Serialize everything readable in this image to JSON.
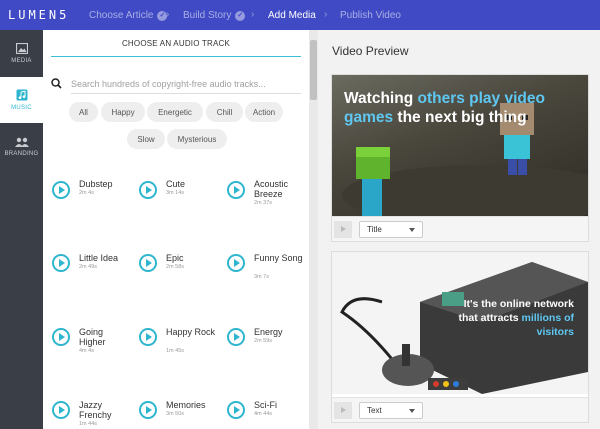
{
  "app": {
    "logo": "LUMEN5"
  },
  "steps": [
    {
      "label": "Choose Article",
      "done": true
    },
    {
      "label": "Build Story",
      "done": true
    },
    {
      "label": "Add Media",
      "done": false,
      "active": true
    },
    {
      "label": "Publish Video",
      "done": false
    }
  ],
  "rail": [
    {
      "label": "MEDIA",
      "icon": "image-icon"
    },
    {
      "label": "MUSIC",
      "icon": "music-icon",
      "active": true
    },
    {
      "label": "BRANDING",
      "icon": "branding-icon"
    }
  ],
  "panel": {
    "title": "CHOOSE AN AUDIO TRACK",
    "search_placeholder": "Search hundreds of copyright-free audio tracks...",
    "filters": [
      "All",
      "Happy",
      "Energetic",
      "Chill",
      "Action",
      "Slow",
      "Mysterious"
    ]
  },
  "tracks": [
    {
      "name": "Dubstep",
      "duration": "2m 4s"
    },
    {
      "name": "Cute",
      "duration": "3m 14s"
    },
    {
      "name": "Acoustic Breeze",
      "duration": "2m 37s"
    },
    {
      "name": "Little Idea",
      "duration": "2m 49s"
    },
    {
      "name": "Epic",
      "duration": "2m 58s"
    },
    {
      "name": "Funny Song",
      "duration": "3m 7s"
    },
    {
      "name": "Going Higher",
      "duration": "4m 4s"
    },
    {
      "name": "Happy Rock",
      "duration": "1m 45s"
    },
    {
      "name": "Energy",
      "duration": "2m 59s"
    },
    {
      "name": "Jazzy Frenchy",
      "duration": "1m 44s"
    },
    {
      "name": "Memories",
      "duration": "3m 50s"
    },
    {
      "name": "Sci-Fi",
      "duration": "4m 44s"
    }
  ],
  "preview": {
    "title": "Video Preview",
    "scenes": [
      {
        "text_parts": [
          "Watching ",
          "others play video games",
          " the next big thing"
        ],
        "layout": "Title"
      },
      {
        "text_parts": [
          "It's the online network that attracts ",
          "millions of visitors"
        ],
        "layout": "Text"
      }
    ]
  },
  "colors": {
    "topbar": "#3f4ac4",
    "accent": "#2fb6cf",
    "rail": "#3a3e47",
    "highlight_text": "#5ec8f2"
  }
}
